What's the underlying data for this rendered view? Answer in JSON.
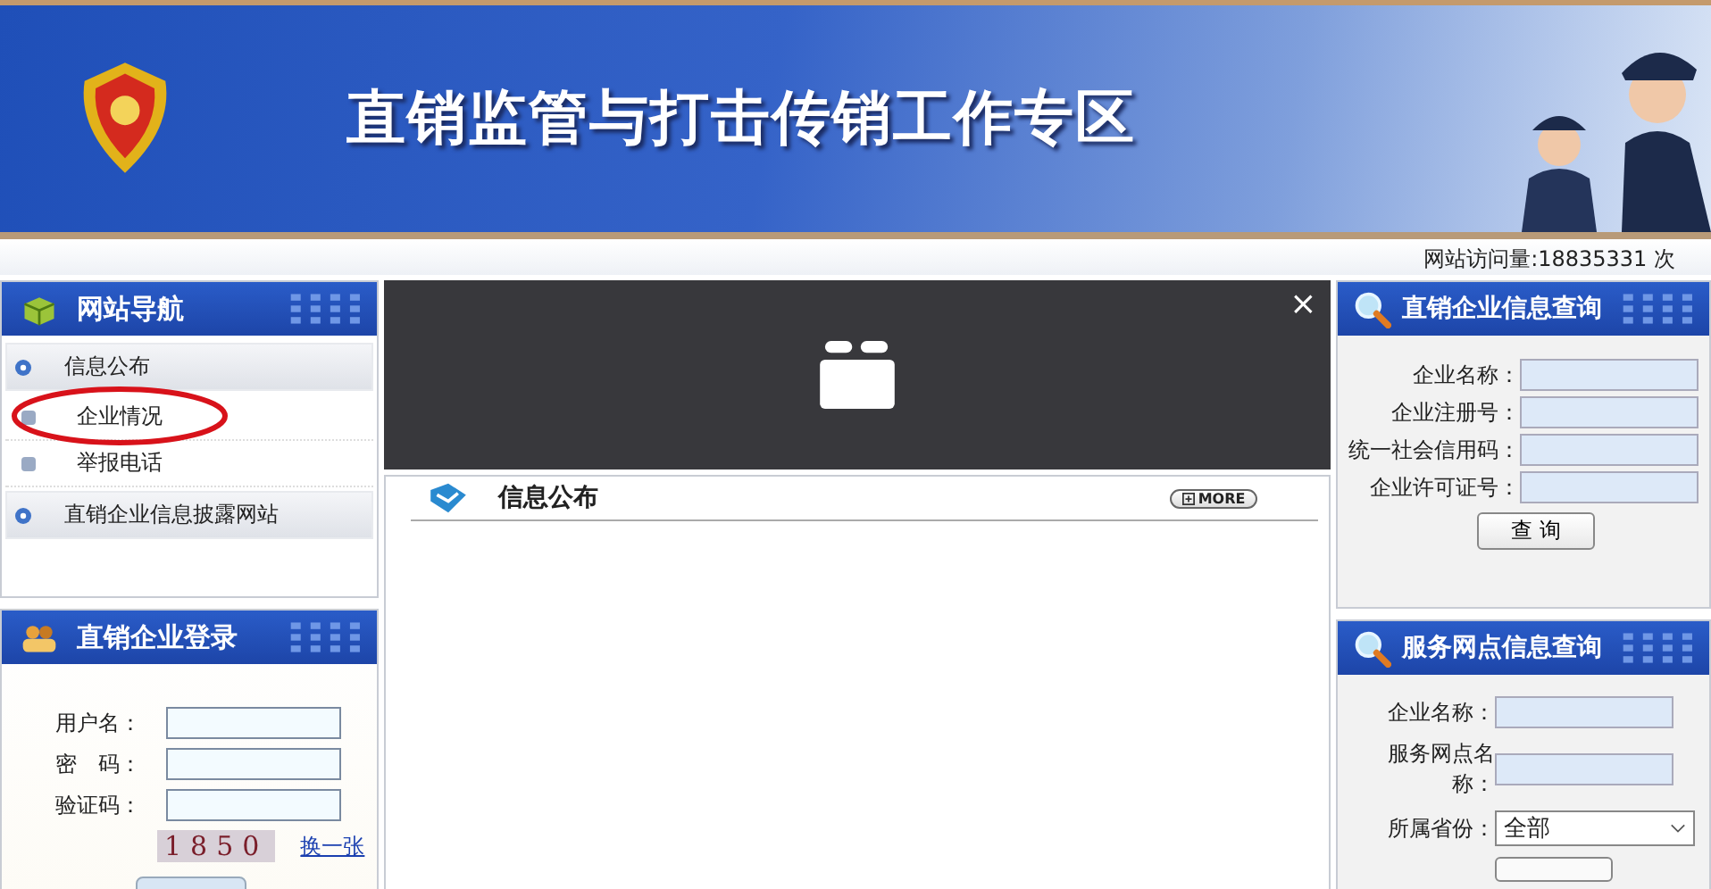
{
  "header": {
    "title": "直销监管与打击传销工作专区"
  },
  "visits": "网站访问量:18835331 次",
  "nav": {
    "title": "网站导航",
    "items": [
      {
        "label": "信息公布",
        "children": [
          {
            "label": "企业情况",
            "highlighted": true
          },
          {
            "label": "举报电话",
            "highlighted": false
          }
        ]
      },
      {
        "label": "直销企业信息披露网站"
      }
    ]
  },
  "login": {
    "title": "直销企业登录",
    "fields": [
      {
        "label": "用户名："
      },
      {
        "label": "密　码："
      },
      {
        "label": "验证码："
      }
    ],
    "captcha": "1850",
    "refresh_link": "换一张"
  },
  "video": {
    "close": "×"
  },
  "news": {
    "title": "信息公布",
    "more": "MORE"
  },
  "query": {
    "title": "直销企业信息查询",
    "fields": [
      {
        "label": "企业名称："
      },
      {
        "label": "企业注册号："
      },
      {
        "label": "统一社会信用码："
      },
      {
        "label": "企业许可证号："
      }
    ],
    "button": "查 询"
  },
  "service": {
    "title": "服务网点信息查询",
    "fields": [
      {
        "label": "企业名称："
      },
      {
        "label": "服务网点名称："
      }
    ],
    "province_label": "所属省份：",
    "province": "全部"
  }
}
